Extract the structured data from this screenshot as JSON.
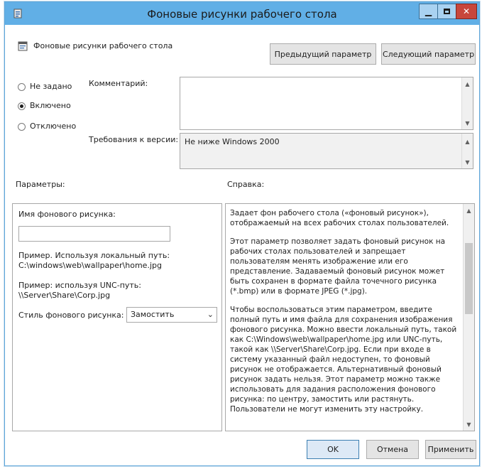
{
  "window": {
    "title": "Фоновые рисунки рабочего стола"
  },
  "header": {
    "policy_name": "Фоновые рисунки рабочего стола",
    "prev_button": "Предыдущий параметр",
    "next_button": "Следующий параметр"
  },
  "state": {
    "options": [
      "Не задано",
      "Включено",
      "Отключено"
    ],
    "selected": "Включено"
  },
  "comment": {
    "label": "Комментарий:",
    "value": ""
  },
  "requirements": {
    "label": "Требования к версии:",
    "value": "Не ниже Windows 2000"
  },
  "params": {
    "heading": "Параметры:",
    "name_label": "Имя фонового рисунка:",
    "name_value": "",
    "example_local_1": "Пример. Используя локальный путь:",
    "example_local_2": "C:\\windows\\web\\wallpaper\\home.jpg",
    "example_unc_1": "Пример: используя UNC-путь:",
    "example_unc_2": "\\\\Server\\Share\\Corp.jpg",
    "style_label": "Стиль фонового рисунка:",
    "style_value": "Замостить"
  },
  "help": {
    "heading": "Справка:",
    "p1": "Задает фон рабочего стола («фоновый рисунок»), отображаемый на всех рабочих столах пользователей.",
    "p2": "Этот параметр позволяет задать фоновый рисунок на рабочих столах пользователей и запрещает пользователям менять изображение или его представление. Задаваемый фоновый рисунок может быть сохранен в формате файла точечного рисунка (*.bmp) или в формате JPEG (*.jpg).",
    "p3": "Чтобы воспользоваться этим параметром, введите полный путь и имя файла для сохранения изображения фонового рисунка. Можно ввести локальный путь, такой как C:\\Windows\\web\\wallpaper\\home.jpg или UNC-путь, такой как \\\\Server\\Share\\Corp.jpg. Если при входе в систему указанный файл недоступен, то фоновый рисунок не отображается. Альтернативный фоновый рисунок задать нельзя. Этот параметр можно также использовать для задания расположения фонового рисунка: по центру, замостить или растянуть. Пользователи не могут изменить эту настройку."
  },
  "footer": {
    "ok": "OK",
    "cancel": "Отмена",
    "apply": "Применить"
  },
  "icons": {
    "app": "policy-icon",
    "minimize": "minimize-icon",
    "maximize": "maximize-icon",
    "close": "close-icon"
  }
}
